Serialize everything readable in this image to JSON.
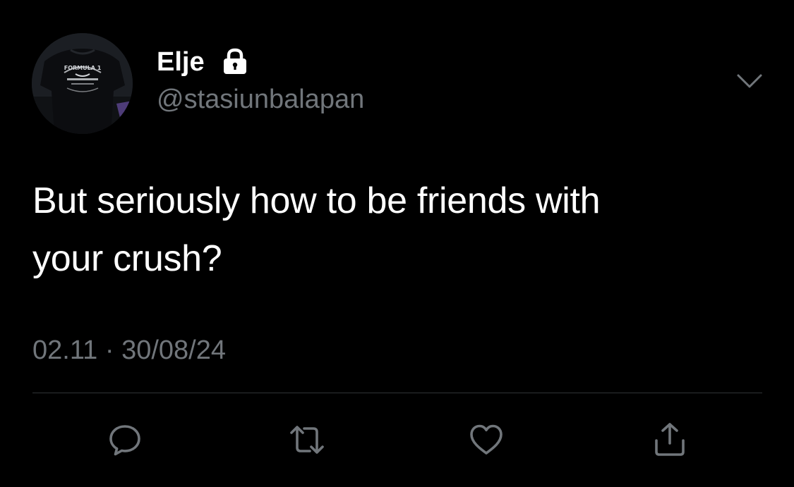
{
  "profile": {
    "display_name": "Elje",
    "handle": "@stasiunbalapan",
    "avatar_shirt_text": "FORMULA 1",
    "lock_icon": "lock-icon"
  },
  "tweet": {
    "text_line1": "But seriously how to be friends with",
    "text_line2": "your crush?",
    "time": "02.11",
    "separator": "·",
    "date": "30/08/24"
  },
  "actions": {
    "reply_icon": "reply-icon",
    "retweet_icon": "retweet-icon",
    "like_icon": "heart-icon",
    "share_icon": "share-icon"
  },
  "colors": {
    "background": "#000000",
    "text": "#ffffff",
    "muted": "#71767b",
    "divider": "#2f3336"
  }
}
